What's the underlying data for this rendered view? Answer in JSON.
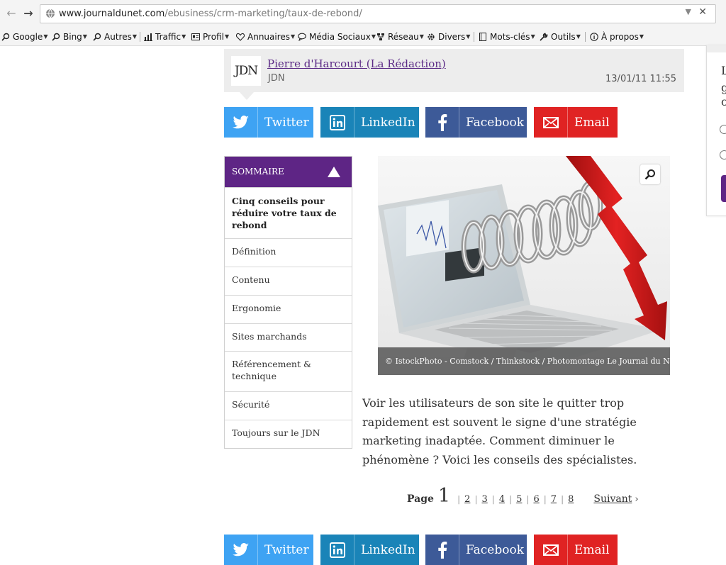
{
  "browser": {
    "url_host": "www.journaldunet.com",
    "url_path": "/ebusiness/crm-marketing/taux-de-rebond/",
    "nav": {
      "back": "back-icon",
      "forward": "forward-icon"
    },
    "bookmarks": [
      {
        "label": "Google",
        "icon": "search-icon"
      },
      {
        "label": "Bing",
        "icon": "search-icon"
      },
      {
        "label": "Autres",
        "icon": "search-icon"
      },
      {
        "label": "Traffic",
        "icon": "bar-chart-icon"
      },
      {
        "label": "Profil",
        "icon": "id-card-icon"
      },
      {
        "label": "Annuaires",
        "icon": "heart-icon"
      },
      {
        "label": "Média Sociaux",
        "icon": "speech-bubble-icon"
      },
      {
        "label": "Réseau",
        "icon": "network-icon"
      },
      {
        "label": "Divers",
        "icon": "gear-icon"
      },
      {
        "label": "Mots-clés",
        "icon": "book-icon"
      },
      {
        "label": "Outils",
        "icon": "wrench-icon"
      },
      {
        "label": "À propos",
        "icon": "info-icon"
      }
    ]
  },
  "author": {
    "logo": "JDN",
    "name": "Pierre d'Harcourt (La Rédaction)",
    "org": "JDN",
    "date": "13/01/11 11:55"
  },
  "share": {
    "twitter": "Twitter",
    "linkedin": "LinkedIn",
    "facebook": "Facebook",
    "email": "Email"
  },
  "sommaire": {
    "title": "SOMMAIRE",
    "items": [
      "Cinq conseils pour réduire votre taux de rebond",
      "Définition",
      "Contenu",
      "Ergonomie",
      "Sites marchands",
      "Référencement & technique",
      "Sécurité",
      "Toujours sur le JDN"
    ]
  },
  "figure": {
    "caption": "© IstockPhoto - Comstock / Thinkstock / Photomontage Le Journal du Net"
  },
  "intro": "Voir les utilisateurs de son site le quitter trop rapidement est souvent le signe d'une stratégie marketing inadaptée. Comment diminuer le phénomène ? Voici les conseils des spécialistes.",
  "pagination": {
    "label": "Page",
    "current": "1",
    "pages": [
      "2",
      "3",
      "4",
      "5",
      "6",
      "7",
      "8"
    ],
    "next": "Suivant"
  },
  "side_panel": {
    "letters": [
      "L",
      "g",
      "c"
    ]
  },
  "colors": {
    "twitter": "#3ea3f3",
    "linkedin": "#1a84b8",
    "facebook": "#3d5a98",
    "email": "#e02323",
    "sommaire": "#5e2585",
    "author_link": "#5b2a86"
  }
}
